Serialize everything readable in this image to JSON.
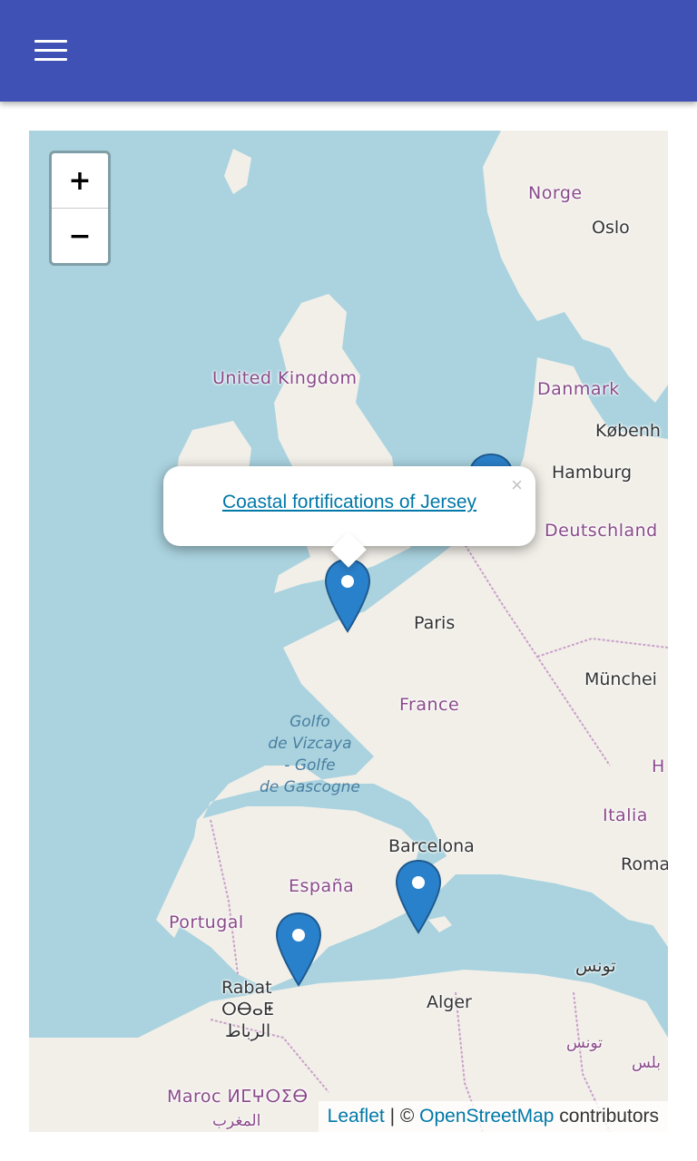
{
  "app_bar": {
    "menu_icon": "hamburger-menu-icon",
    "color": "#3f51b5"
  },
  "map": {
    "zoom_in_label": "+",
    "zoom_out_label": "−",
    "labels": {
      "norge": "Norge",
      "oslo": "Oslo",
      "united_kingdom": "United Kingdom",
      "danmark": "Danmark",
      "kobenhavn": "Københ",
      "hamburg": "Hamburg",
      "deutschland": "Deutschland",
      "paris": "Paris",
      "munchen": "Münchei",
      "france": "France",
      "golfo": "Golfo\nde Vizcaya\n- Golfe\nde Gascogne",
      "italia": "Italia",
      "roma": "Roma",
      "barcelona": "Barcelona",
      "espana": "España",
      "portugal": "Portugal",
      "rabat": "Rabat",
      "rabat_tif": "ⵔⴱⴰⵟ",
      "rabat_ar": "الرباط",
      "alger": "Alger",
      "tunis_ar": "تونس",
      "tunisia_ar": "تونس",
      "maroc": "Maroc ⵍⵎⵖⵔⵉⴱ",
      "maghreb_ar": "المغرب",
      "nablus_ar": "بلس",
      "h_partial": "H"
    },
    "popup": {
      "link_text": "Coastal fortifications of Jersey",
      "close_label": "×"
    },
    "attribution": {
      "leaflet": "Leaflet",
      "separator": " | © ",
      "osm": "OpenStreetMap",
      "suffix": " contributors"
    },
    "marker_color": "#2a81cb"
  }
}
